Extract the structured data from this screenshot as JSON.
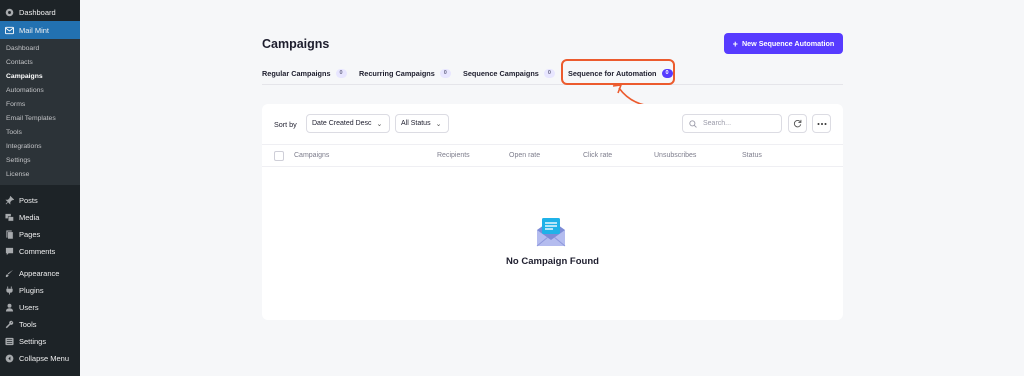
{
  "sidebar": {
    "top_items": [
      {
        "label": "Dashboard",
        "icon": "dashboard-icon"
      },
      {
        "label": "Mail Mint",
        "icon": "mail-icon"
      }
    ],
    "submenu": [
      "Dashboard",
      "Contacts",
      "Campaigns",
      "Automations",
      "Forms",
      "Email Templates",
      "Tools",
      "Integrations",
      "Settings",
      "License"
    ],
    "submenu_current": "Campaigns",
    "bottom_items": [
      {
        "label": "Posts",
        "icon": "pin-icon"
      },
      {
        "label": "Media",
        "icon": "media-icon"
      },
      {
        "label": "Pages",
        "icon": "pages-icon"
      },
      {
        "label": "Comments",
        "icon": "comment-icon"
      },
      {
        "label": "Appearance",
        "icon": "brush-icon"
      },
      {
        "label": "Plugins",
        "icon": "plug-icon"
      },
      {
        "label": "Users",
        "icon": "user-icon"
      },
      {
        "label": "Tools",
        "icon": "wrench-icon"
      },
      {
        "label": "Settings",
        "icon": "settings-icon"
      },
      {
        "label": "Collapse Menu",
        "icon": "collapse-icon"
      }
    ]
  },
  "header": {
    "title": "Campaigns",
    "new_button": "New Sequence Automation"
  },
  "tabs": [
    {
      "label": "Regular Campaigns",
      "count": "0"
    },
    {
      "label": "Recurring Campaigns",
      "count": "0"
    },
    {
      "label": "Sequence Campaigns",
      "count": "0"
    },
    {
      "label": "Sequence for Automation",
      "count": "0"
    }
  ],
  "active_tab": "Sequence for Automation",
  "toolbar": {
    "sort_label": "Sort by",
    "sort_value": "Date Created Desc",
    "status_value": "All Status",
    "search_placeholder": "Search..."
  },
  "table": {
    "columns": [
      "Campaigns",
      "Recipients",
      "Open rate",
      "Click rate",
      "Unsubscribes",
      "Status"
    ],
    "rows": []
  },
  "empty_state": "No Campaign Found",
  "colors": {
    "accent": "#573bff",
    "sidebar_bg": "#1d2327",
    "sidebar_active": "#2271b1",
    "highlight": "#ec5b2e"
  }
}
